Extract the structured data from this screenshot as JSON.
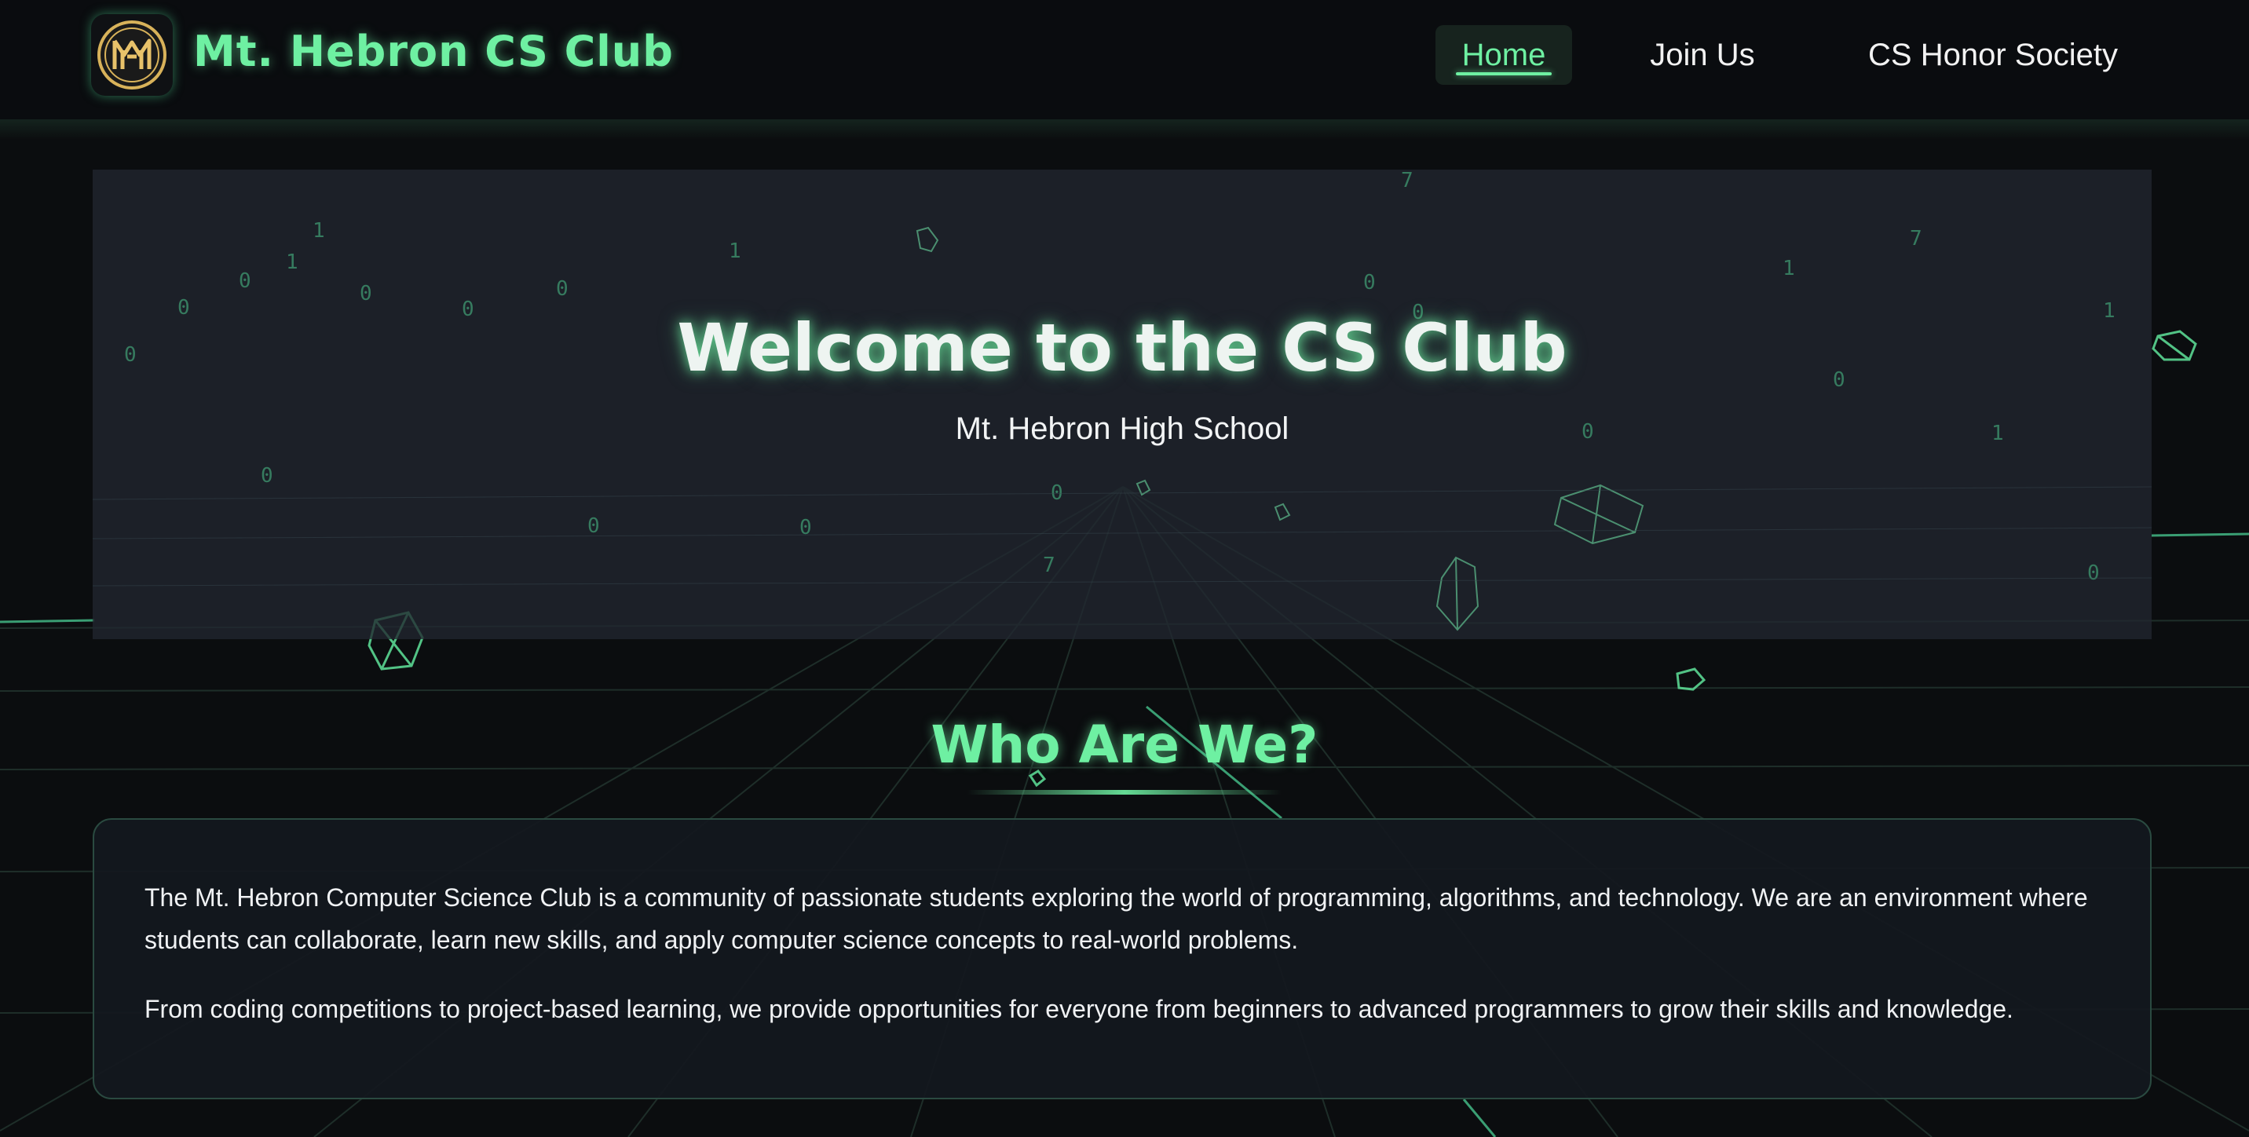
{
  "header": {
    "brand": "Mt. Hebron CS Club",
    "logo_icon": "mt-hebron-logo-icon",
    "nav": [
      {
        "label": "Home",
        "active": true
      },
      {
        "label": "Join Us",
        "active": false
      },
      {
        "label": "CS Honor Society",
        "active": false
      }
    ]
  },
  "hero": {
    "title": "Welcome to the CS Club",
    "subtitle": "Mt. Hebron High School"
  },
  "about": {
    "heading": "Who Are We?",
    "paragraphs": [
      "The Mt. Hebron Computer Science Club is a community of passionate students exploring the world of programming, algorithms, and technology. We are an environment where students can collaborate, learn new skills, and apply computer science concepts to real-world problems.",
      "From coding competitions to project-based learning, we provide opportunities for everyone from beginners to advanced programmers to grow their skills and knowledge."
    ]
  },
  "colors": {
    "accent": "#6ef0a2",
    "background": "#0b0d0f",
    "panel": "#212630"
  }
}
